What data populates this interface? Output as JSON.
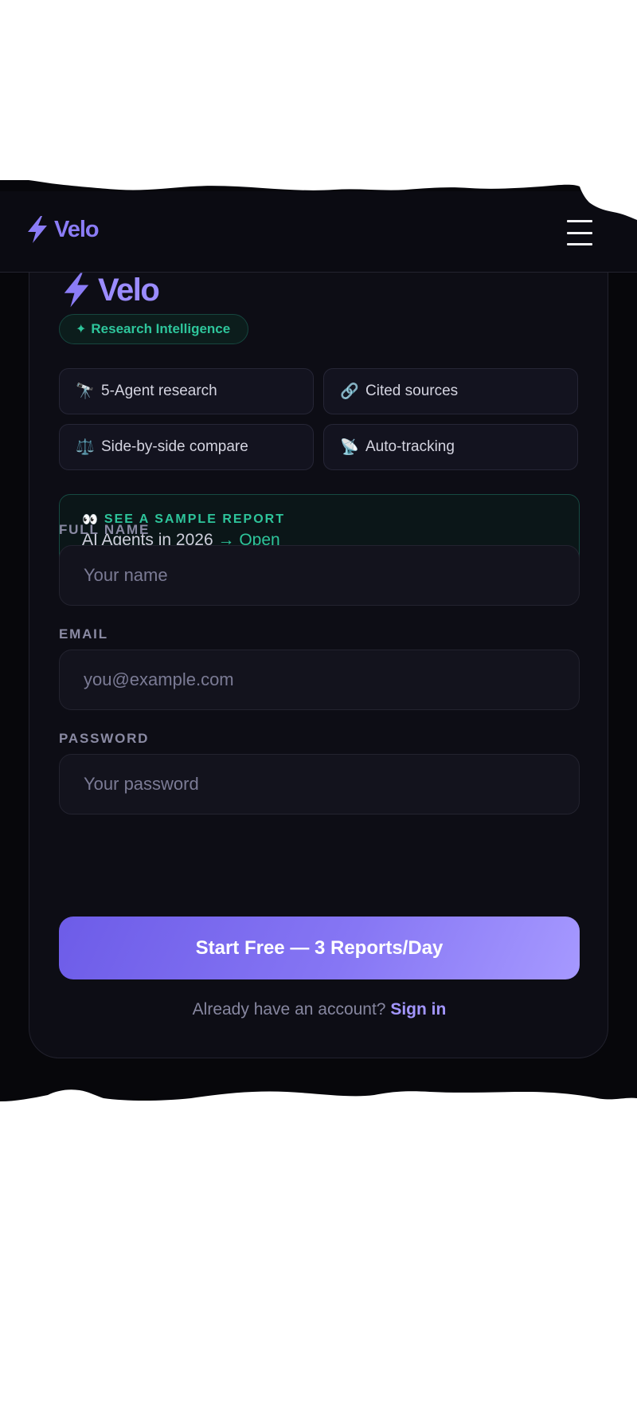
{
  "navbar": {
    "brand": "Velo",
    "menu_icon": "hamburger-menu-icon"
  },
  "card": {
    "brand": "Velo",
    "badge": {
      "icon": "sparkle-icon",
      "label": "Research Intelligence"
    },
    "features": [
      {
        "icon": "🔭",
        "icon_name": "telescope-icon",
        "label": "5-Agent research"
      },
      {
        "icon": "🔗",
        "icon_name": "link-icon",
        "label": "Cited sources"
      },
      {
        "icon": "⚖️",
        "icon_name": "scales-icon",
        "label": "Side-by-side compare"
      },
      {
        "icon": "📡",
        "icon_name": "satellite-dish-icon",
        "label": "Auto-tracking"
      }
    ],
    "sample_report": {
      "icon": "👀",
      "kicker": "SEE A SAMPLE REPORT",
      "title": "AI Agents in 2026",
      "arrow": "→",
      "action": "Open"
    },
    "form": {
      "full_name": {
        "label": "FULL NAME",
        "placeholder": "Your name",
        "value": ""
      },
      "email": {
        "label": "EMAIL",
        "placeholder": "you@example.com",
        "value": ""
      },
      "password": {
        "label": "PASSWORD",
        "placeholder": "Your password",
        "value": ""
      },
      "submit_label": "Start Free — 3 Reports/Day"
    },
    "signin": {
      "prompt": "Already have an account?",
      "link": "Sign in"
    }
  },
  "colors": {
    "accent": "#8b7cf6",
    "success": "#2ec59b",
    "background": "#0d0d15"
  }
}
